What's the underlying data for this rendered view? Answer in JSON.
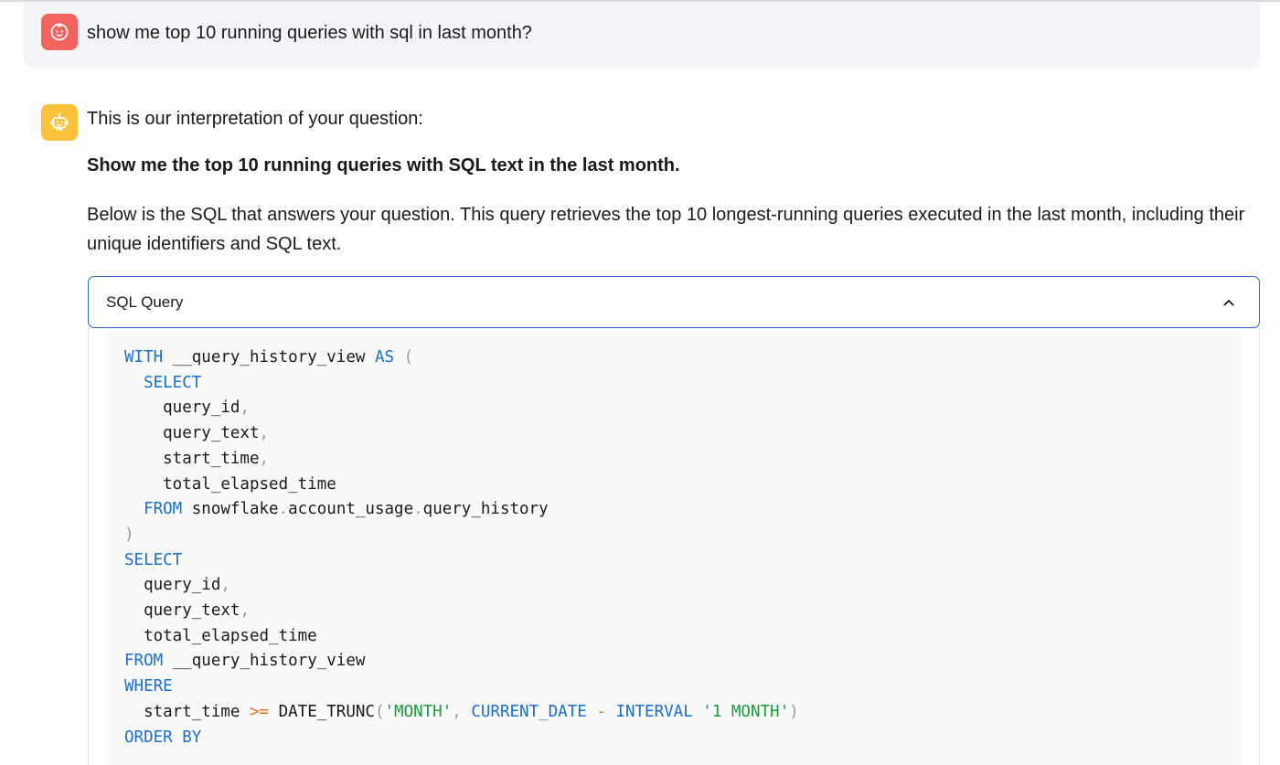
{
  "user_message": {
    "text": "show me top 10 running queries with sql in last month?"
  },
  "assistant_message": {
    "intro": "This is our interpretation of your question:",
    "interpretation": "Show me the top 10 running queries with SQL text in the last month.",
    "description": "Below is the SQL that answers your question. This query retrieves the top 10 longest-running queries executed in the last month, including their unique identifiers and SQL text."
  },
  "sql_panel": {
    "title": "SQL Query",
    "expanded": true,
    "lines": [
      [
        {
          "t": "WITH",
          "c": "kw"
        },
        {
          "t": " __query_history_view "
        },
        {
          "t": "AS",
          "c": "kw"
        },
        {
          "t": " "
        },
        {
          "t": "(",
          "c": "pn"
        }
      ],
      [
        {
          "t": "  "
        },
        {
          "t": "SELECT",
          "c": "kw"
        }
      ],
      [
        {
          "t": "    query_id"
        },
        {
          "t": ",",
          "c": "pn"
        }
      ],
      [
        {
          "t": "    query_text"
        },
        {
          "t": ",",
          "c": "pn"
        }
      ],
      [
        {
          "t": "    start_time"
        },
        {
          "t": ",",
          "c": "pn"
        }
      ],
      [
        {
          "t": "    total_elapsed_time"
        }
      ],
      [
        {
          "t": "  "
        },
        {
          "t": "FROM",
          "c": "kw"
        },
        {
          "t": " snowflake"
        },
        {
          "t": ".",
          "c": "pn"
        },
        {
          "t": "account_usage"
        },
        {
          "t": ".",
          "c": "pn"
        },
        {
          "t": "query_history"
        }
      ],
      [
        {
          "t": ")",
          "c": "pn"
        }
      ],
      [
        {
          "t": "SELECT",
          "c": "kw"
        }
      ],
      [
        {
          "t": "  query_id"
        },
        {
          "t": ",",
          "c": "pn"
        }
      ],
      [
        {
          "t": "  query_text"
        },
        {
          "t": ",",
          "c": "pn"
        }
      ],
      [
        {
          "t": "  total_elapsed_time"
        }
      ],
      [
        {
          "t": "FROM",
          "c": "kw"
        },
        {
          "t": " __query_history_view"
        }
      ],
      [
        {
          "t": "WHERE",
          "c": "kw"
        }
      ],
      [
        {
          "t": "  start_time "
        },
        {
          "t": ">=",
          "c": "op"
        },
        {
          "t": " DATE_TRUNC"
        },
        {
          "t": "(",
          "c": "pn"
        },
        {
          "t": "'MONTH'",
          "c": "str"
        },
        {
          "t": ",",
          "c": "pn"
        },
        {
          "t": " "
        },
        {
          "t": "CURRENT_DATE",
          "c": "kw"
        },
        {
          "t": " "
        },
        {
          "t": "-",
          "c": "op"
        },
        {
          "t": " "
        },
        {
          "t": "INTERVAL",
          "c": "kw"
        },
        {
          "t": " "
        },
        {
          "t": "'1 MONTH'",
          "c": "str"
        },
        {
          "t": ")",
          "c": "pn"
        }
      ],
      [
        {
          "t": "ORDER BY",
          "c": "kw"
        }
      ]
    ]
  },
  "icons": {
    "user_avatar": "baby-face-icon",
    "bot_avatar": "robot-icon",
    "accordion_toggle": "chevron-up-icon"
  },
  "colors": {
    "user_avatar_bg": "#f2655f",
    "bot_avatar_bg": "#fbc13a",
    "accordion_border": "#2f6ad1",
    "sql_keyword": "#1a6fd1",
    "sql_string": "#1c9a3c",
    "sql_operator": "#e0721c",
    "sql_punctuation": "#9a9a9a"
  }
}
